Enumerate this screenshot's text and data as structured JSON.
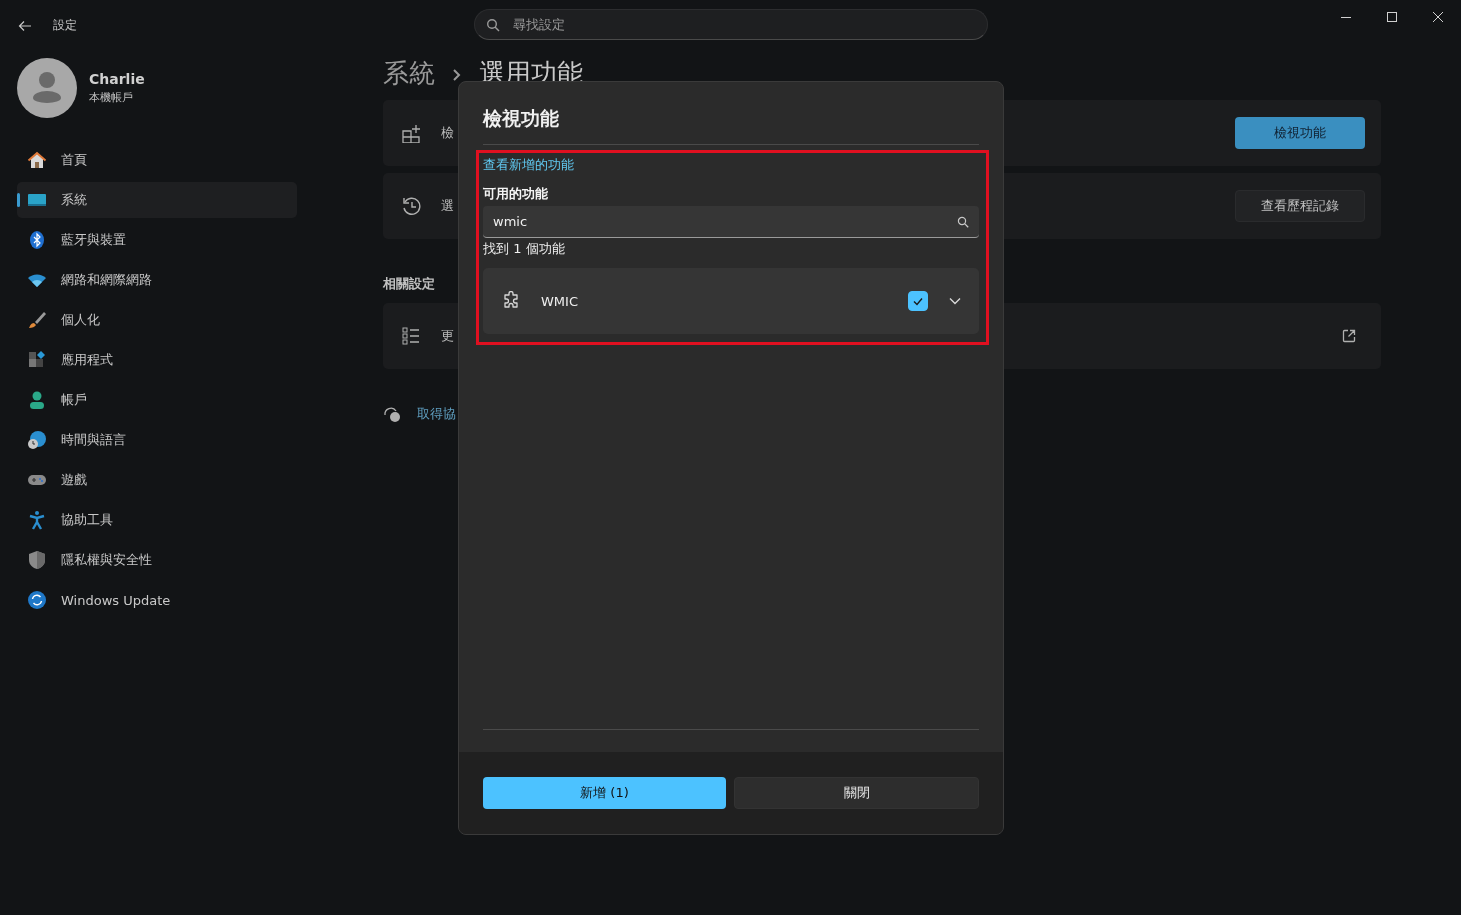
{
  "window": {
    "title": "設定",
    "search_placeholder": "尋找設定"
  },
  "profile": {
    "name": "Charlie",
    "account": "本機帳戶"
  },
  "sidebar": {
    "items": [
      {
        "label": "首頁",
        "selected": false
      },
      {
        "label": "系統",
        "selected": true
      },
      {
        "label": "藍牙與裝置",
        "selected": false
      },
      {
        "label": "網路和網際網路",
        "selected": false
      },
      {
        "label": "個人化",
        "selected": false
      },
      {
        "label": "應用程式",
        "selected": false
      },
      {
        "label": "帳戶",
        "selected": false
      },
      {
        "label": "時間與語言",
        "selected": false
      },
      {
        "label": "遊戲",
        "selected": false
      },
      {
        "label": "協助工具",
        "selected": false
      },
      {
        "label": "隱私權與安全性",
        "selected": false
      },
      {
        "label": "Windows Update",
        "selected": false
      }
    ]
  },
  "breadcrumb": [
    "系統",
    "選用功能"
  ],
  "cards": [
    {
      "label": "檢",
      "button": {
        "label": "檢視功能",
        "kind": "primary"
      }
    },
    {
      "label": "選",
      "button": {
        "label": "查看歷程記錄",
        "kind": "secondary"
      }
    }
  ],
  "related_settings": {
    "heading": "相關設定",
    "items": [
      {
        "label": "更"
      }
    ]
  },
  "help_link": "取得協",
  "dialog": {
    "title": "檢視功能",
    "link": "查看新增的功能",
    "section_label": "可用的功能",
    "search": {
      "value": "wmic"
    },
    "result_count": "找到 1 個功能",
    "features": [
      {
        "name": "WMIC",
        "checked": true,
        "expanded": false
      }
    ],
    "buttons": [
      {
        "label": "新增 (1)",
        "kind": "primary"
      },
      {
        "label": "關閉",
        "kind": "secondary"
      }
    ]
  }
}
